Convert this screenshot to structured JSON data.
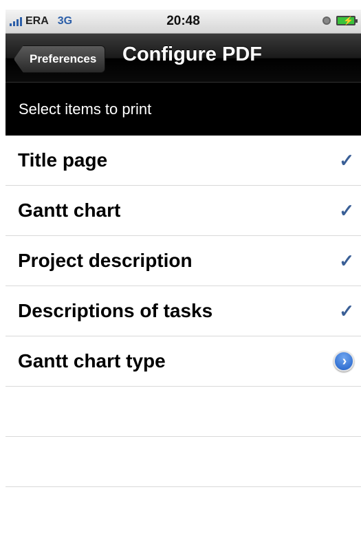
{
  "status_bar": {
    "carrier": "ERA",
    "network": "3G",
    "time": "20:48",
    "icons": [
      "signal-icon",
      "alarm-icon",
      "battery-charging-icon"
    ]
  },
  "nav": {
    "back_label": "Preferences",
    "title": "Configure PDF"
  },
  "subheader": {
    "text": "Select items to print"
  },
  "list": {
    "items": [
      {
        "label": "Title page",
        "accessory": "checkmark"
      },
      {
        "label": "Gantt chart",
        "accessory": "checkmark"
      },
      {
        "label": "Project description",
        "accessory": "checkmark"
      },
      {
        "label": "Descriptions of tasks",
        "accessory": "checkmark"
      },
      {
        "label": "Gantt chart type",
        "accessory": "disclosure"
      }
    ],
    "checkmark_glyph": "✓",
    "disclosure_glyph": "›"
  },
  "colors": {
    "checkmark": "#3a5f96",
    "disclosure": "#1f5fc8",
    "network": "#2b5ea8"
  }
}
